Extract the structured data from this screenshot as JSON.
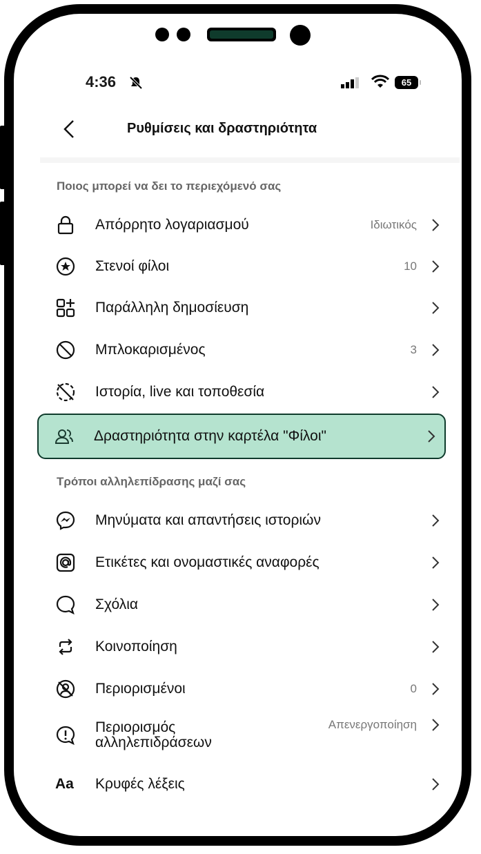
{
  "status": {
    "time": "4:36",
    "battery": "65"
  },
  "header": {
    "title": "Ρυθμίσεις και δραστηριότητα"
  },
  "sections": {
    "visibility": "Ποιος μπορεί να δει το περιεχόμενό σας",
    "interactions": "Τρόποι αλληλεπίδρασης μαζί σας"
  },
  "items": [
    {
      "label": "Απόρρητο λογαριασμού",
      "value": "Ιδιωτικός",
      "icon": "lock-icon"
    },
    {
      "label": "Στενοί φίλοι",
      "value": "10",
      "icon": "star-circle-icon"
    },
    {
      "label": "Παράλληλη δημοσίευση",
      "value": "",
      "icon": "grid-add-icon"
    },
    {
      "label": "Μπλοκαρισμένος",
      "value": "3",
      "icon": "block-icon"
    },
    {
      "label": "Ιστορία, live και τοποθεσία",
      "value": "",
      "icon": "story-hidden-icon"
    },
    {
      "label": "Δραστηριότητα στην καρτέλα \"Φίλοι\"",
      "value": "",
      "icon": "friends-icon"
    },
    {
      "label": "Μηνύματα και απαντήσεις ιστοριών",
      "value": "",
      "icon": "messenger-icon"
    },
    {
      "label": "Ετικέτες και ονομαστικές αναφορές",
      "value": "",
      "icon": "at-icon"
    },
    {
      "label": "Σχόλια",
      "value": "",
      "icon": "comment-icon"
    },
    {
      "label": "Κοινοποίηση",
      "value": "",
      "icon": "share-icon"
    },
    {
      "label": "Περιορισμένοι",
      "value": "0",
      "icon": "restricted-icon"
    },
    {
      "label": "Περιορισμός αλληλεπιδράσεων",
      "value": "Απενεργοποίηση",
      "icon": "alert-icon"
    },
    {
      "label": "Κρυφές λέξεις",
      "value": "",
      "icon": "text-icon"
    }
  ],
  "icon_text": "Aa",
  "colors": {
    "highlight": "#b5e3cf",
    "highlight_border": "#0f3b2c"
  }
}
